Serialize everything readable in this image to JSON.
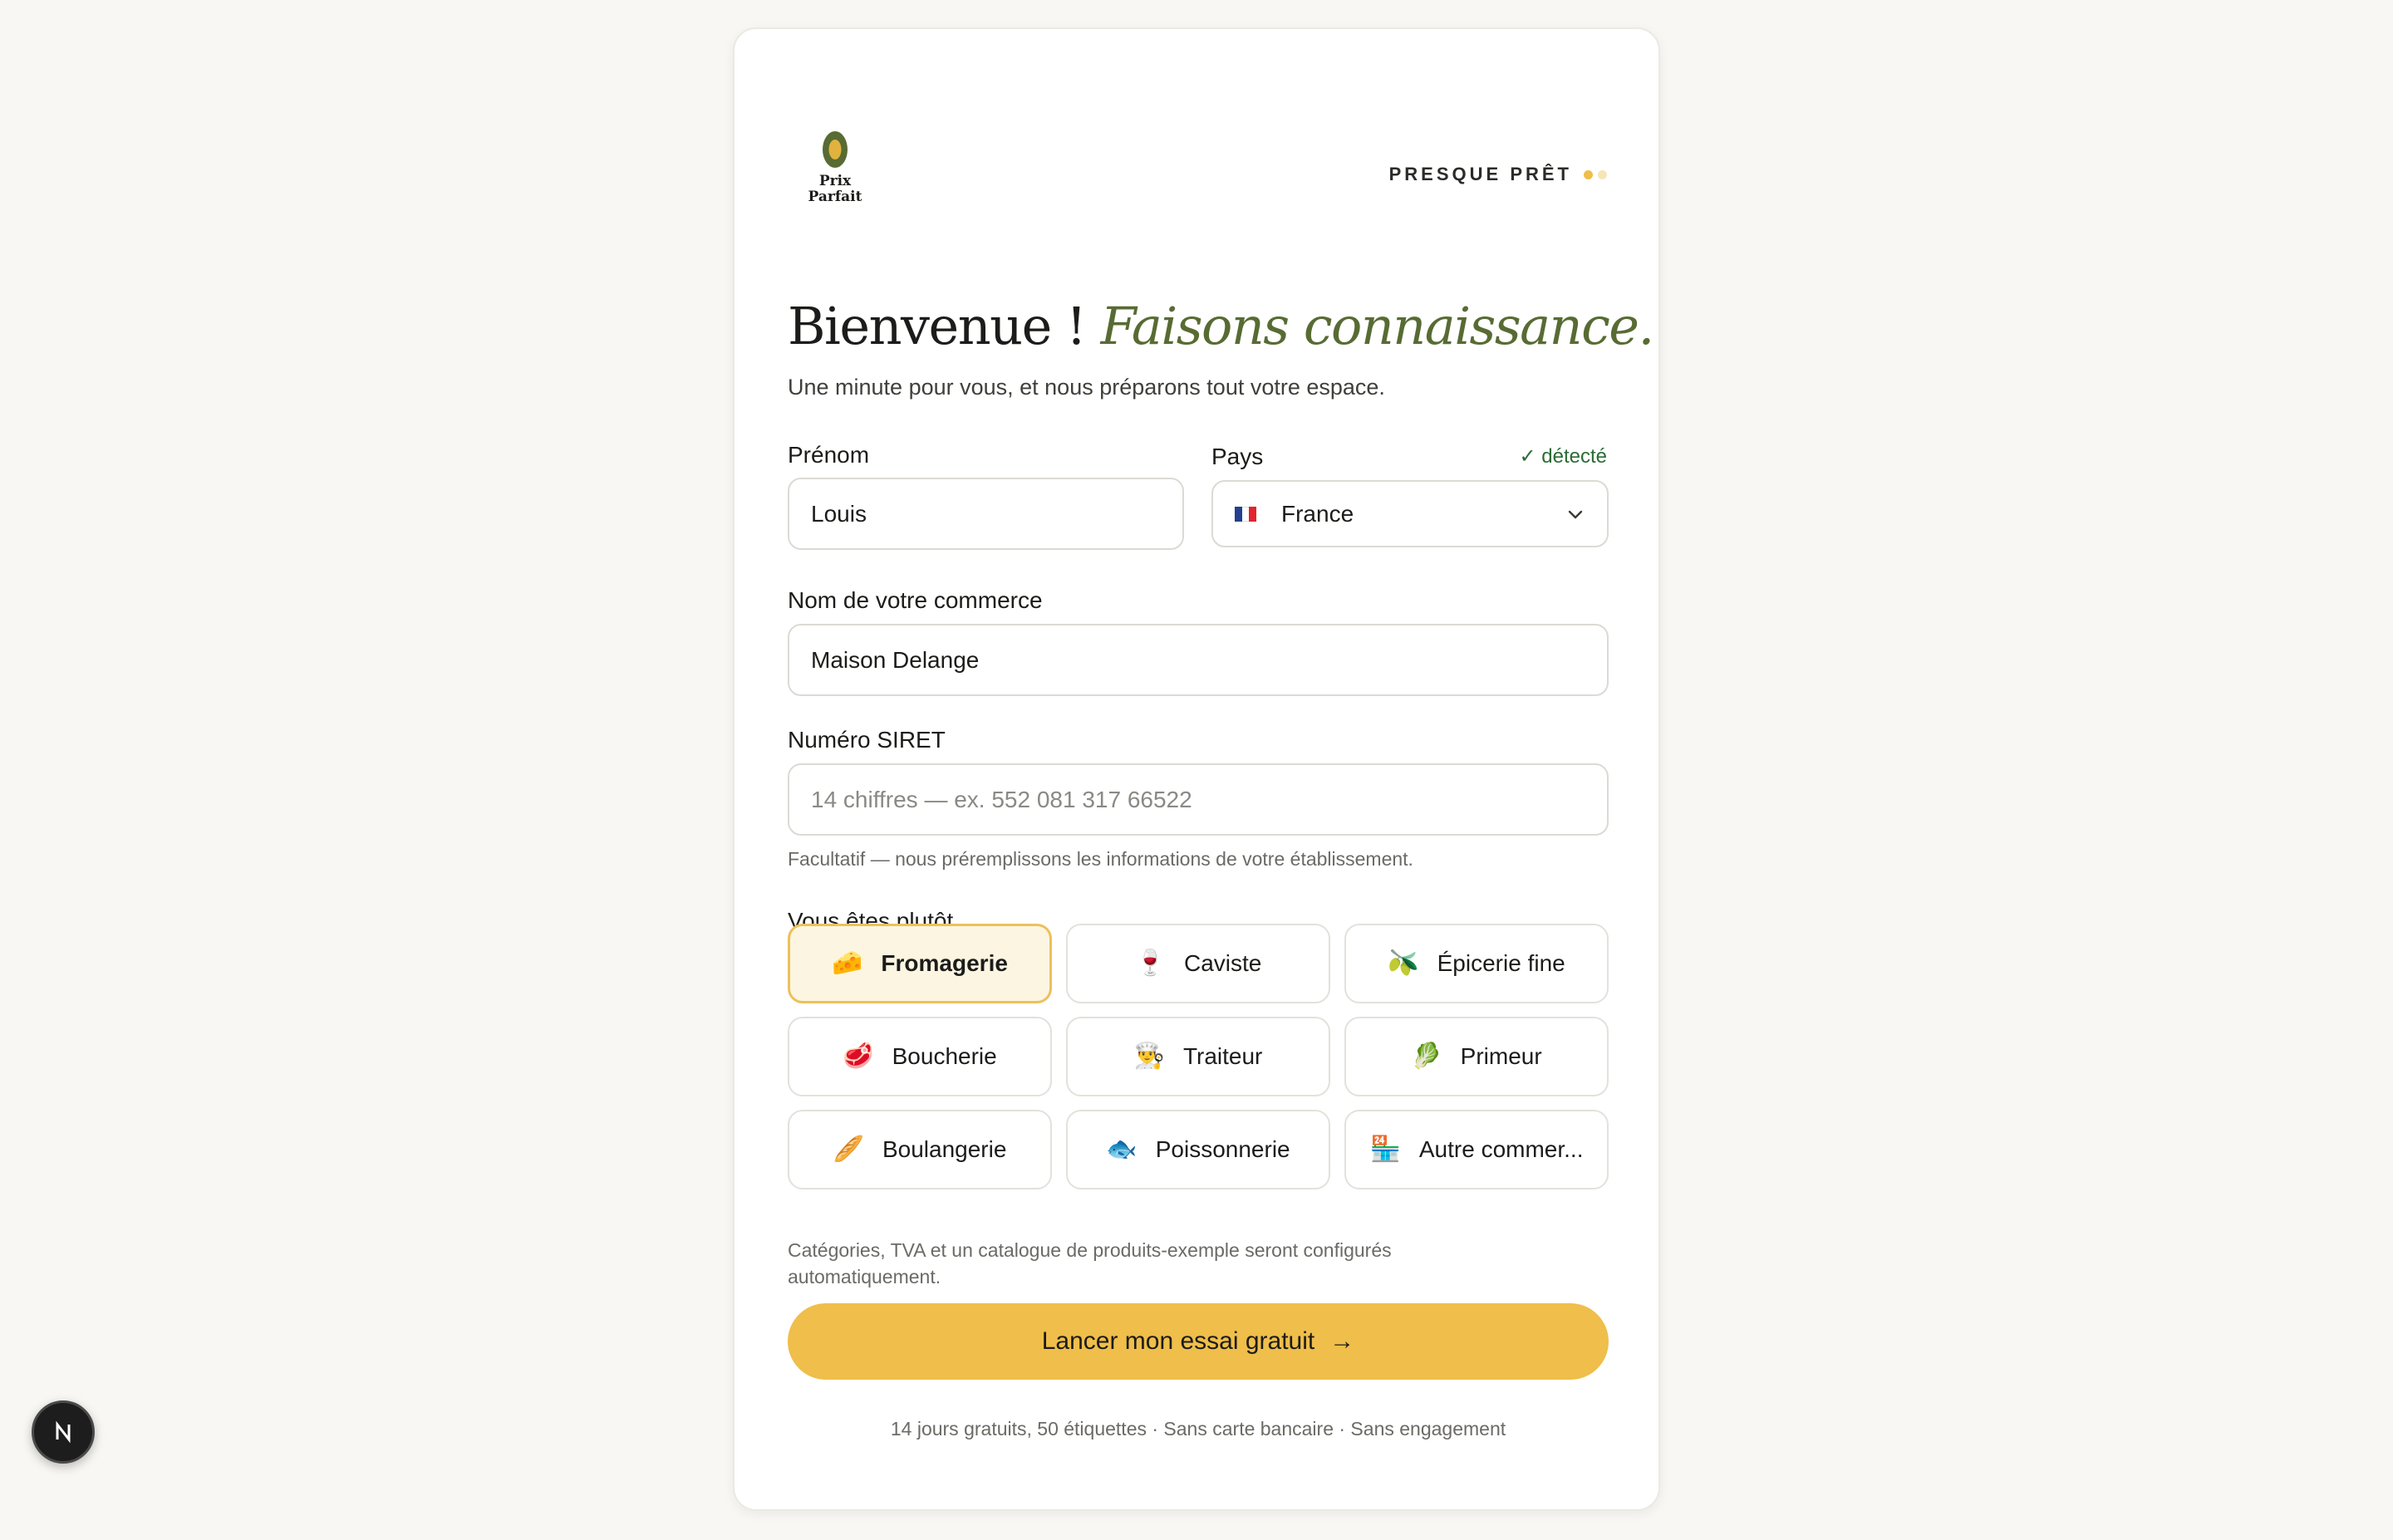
{
  "brand": {
    "name_line1": "Prix",
    "name_line2": "Parfait"
  },
  "progress": {
    "label": "PRESQUE PRÊT",
    "steps_total": 2,
    "steps_done": 1
  },
  "header": {
    "title_plain": "Bienvenue !",
    "title_emphasis": "Faisons connaissance.",
    "subtitle": "Une minute pour vous, et nous préparons tout votre espace."
  },
  "form": {
    "first_name": {
      "label": "Prénom",
      "value": "Louis"
    },
    "country": {
      "label": "Pays",
      "detected": "✓ détecté",
      "value": "France"
    },
    "business_name": {
      "label": "Nom de votre commerce",
      "value": "Maison Delange"
    },
    "siret": {
      "label": "Numéro SIRET",
      "placeholder": "14 chiffres — ex. 552 081 317 66522",
      "help": "Facultatif — nous préremplissons les informations de votre établissement."
    },
    "business_type": {
      "label": "Vous êtes plutôt...",
      "selected": "Fromagerie",
      "options": [
        {
          "label": "Fromagerie",
          "icon": "🧀"
        },
        {
          "label": "Caviste",
          "icon": "🍷"
        },
        {
          "label": "Épicerie fine",
          "icon": "🫒"
        },
        {
          "label": "Boucherie",
          "icon": "🥩"
        },
        {
          "label": "Traiteur",
          "icon": "👨‍🍳"
        },
        {
          "label": "Primeur",
          "icon": "🥬"
        },
        {
          "label": "Boulangerie",
          "icon": "🥖"
        },
        {
          "label": "Poissonnerie",
          "icon": "🐟"
        },
        {
          "label": "Autre commer...",
          "icon": "🏪"
        }
      ],
      "help": "Catégories, TVA et un catalogue de produits-exemple seront configurés automatiquement."
    }
  },
  "cta": {
    "label": "Lancer mon essai gratuit",
    "arrow": "→"
  },
  "footer": "14 jours gratuits, 50 étiquettes · Sans carte bancaire · Sans engagement",
  "dev_badge": {
    "letter": "N"
  },
  "colors": {
    "accent": "#efbe4b",
    "olive": "#586b33",
    "success": "#2c6b35",
    "background": "#f8f7f3"
  }
}
